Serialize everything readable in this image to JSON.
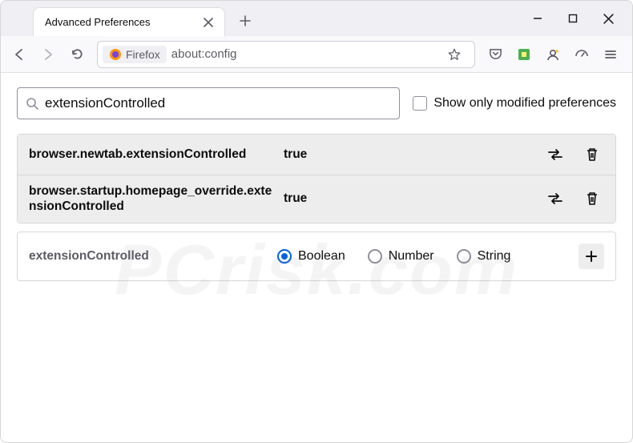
{
  "tab": {
    "title": "Advanced Preferences"
  },
  "urlbar": {
    "label": "Firefox",
    "url": "about:config"
  },
  "search": {
    "value": "extensionControlled",
    "modified_label": "Show only modified preferences"
  },
  "prefs": {
    "rows": [
      {
        "name": "browser.newtab.extensionControlled",
        "value": "true"
      },
      {
        "name": "browser.startup.homepage_override.extensionControlled",
        "value": "true"
      }
    ]
  },
  "new_pref": {
    "name": "extensionControlled",
    "types": {
      "boolean": "Boolean",
      "number": "Number",
      "string": "String"
    }
  },
  "watermark": "PCrisk.com"
}
